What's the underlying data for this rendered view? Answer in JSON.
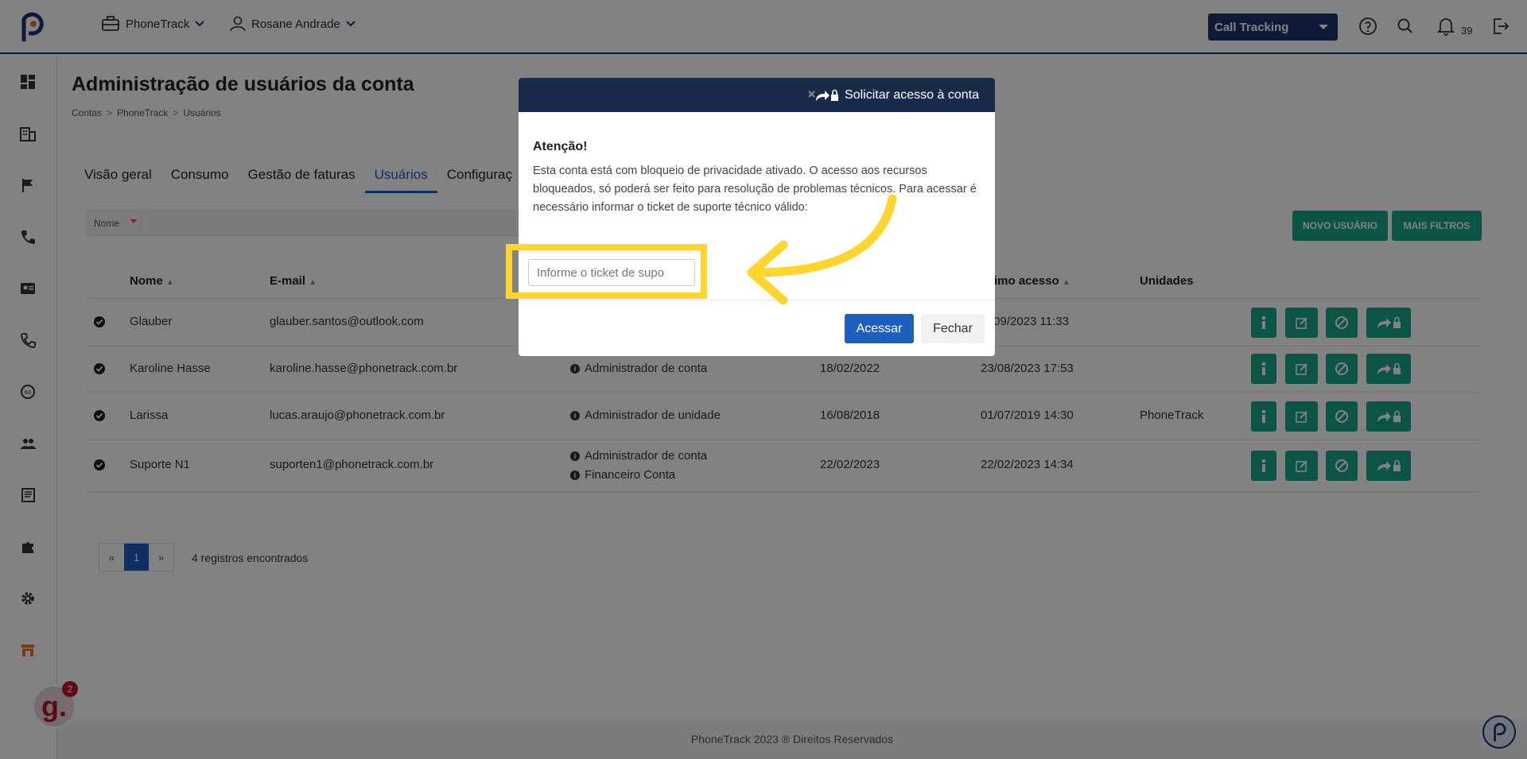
{
  "header": {
    "company_menu": "PhoneTrack",
    "user_menu": "Rosane Andrade",
    "product_select": "Call Tracking",
    "notification_count": "39"
  },
  "page": {
    "title": "Administração de usuários da conta",
    "breadcrumb": [
      "Contas",
      "PhoneTrack",
      "Usuários"
    ],
    "breadcrumb_separator": ">"
  },
  "tabs": [
    "Visão geral",
    "Consumo",
    "Gestão de faturas",
    "Usuários",
    "Configuraç"
  ],
  "filter": {
    "field_label": "Nome"
  },
  "buttons": {
    "new_user": "NOVO USUÁRIO",
    "more_filters": "MAIS FILTROS"
  },
  "table": {
    "columns": {
      "name": "Nome",
      "email": "E-mail",
      "last_access": "timo acesso",
      "units": "Unidades"
    },
    "rows": [
      {
        "name": "Glauber",
        "email": "glauber.santos@outlook.com",
        "roles": [],
        "created": "",
        "last_access": "/09/2023 11:33",
        "unit": ""
      },
      {
        "name": "Karoline Hasse",
        "email": "karoline.hasse@phonetrack.com.br",
        "roles": [
          "Administrador de conta"
        ],
        "created": "18/02/2022",
        "last_access": "23/08/2023 17:53",
        "unit": ""
      },
      {
        "name": "Larissa",
        "email": "lucas.araujo@phonetrack.com.br",
        "roles": [
          "Administrador de unidade"
        ],
        "created": "16/08/2018",
        "last_access": "01/07/2019 14:30",
        "unit": "PhoneTrack"
      },
      {
        "name": "Suporte N1",
        "email": "suporten1@phonetrack.com.br",
        "roles": [
          "Administrador de conta",
          "Financeiro Conta"
        ],
        "created": "22/02/2023",
        "last_access": "22/02/2023 14:34",
        "unit": ""
      }
    ]
  },
  "pagination": {
    "prev": "«",
    "current": "1",
    "next": "»",
    "summary": "4 registros encontrados"
  },
  "footer": "PhoneTrack 2023 ® Direitos Reservados",
  "modal": {
    "title": "Solicitar acesso à conta",
    "attention_title": "Atenção!",
    "attention_text": "Esta conta está com bloqueio de privacidade ativado. O acesso aos recursos bloqueados, só poderá ser feito para resolução de problemas técnicos. Para acessar é necessário informar o ticket de suporte técnico válido:",
    "ticket_placeholder": "Informe o ticket de supo",
    "access_button": "Acessar",
    "close_button": "Fechar"
  },
  "floating": {
    "g_badge_count": "2"
  },
  "colors": {
    "primary": "#1d5fbf",
    "navy": "#1a3473",
    "green": "#17a589",
    "highlight": "#ffd52e"
  }
}
